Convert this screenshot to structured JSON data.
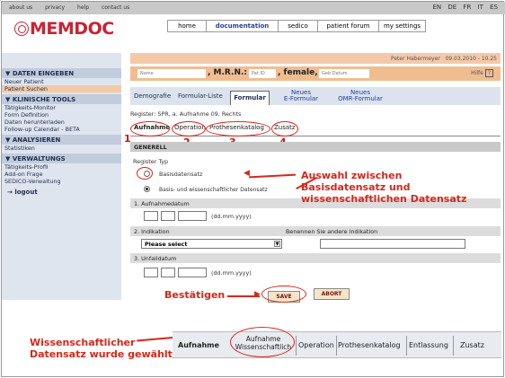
{
  "top_links": [
    "about us",
    "privacy",
    "help",
    "contact us"
  ],
  "languages": [
    "EN",
    "DE",
    "FR",
    "IT",
    "ES"
  ],
  "logo": {
    "text": "MEMDOC"
  },
  "top_nav": [
    {
      "label": "home"
    },
    {
      "label": "documentation"
    },
    {
      "label": "sedico"
    },
    {
      "label": "patient forum"
    },
    {
      "label": "my settings"
    }
  ],
  "sidebar": {
    "sections": [
      {
        "title": "DATEN EINGEBEN",
        "items": [
          "Neuer Patient",
          "Patient Suchen"
        ]
      },
      {
        "title": "KLINISCHE TOOLS",
        "items": [
          "Tätigkeits-Monitor",
          "Form Definition",
          "Daten herunterladen",
          "Follow-up Calendar - BETA"
        ]
      },
      {
        "title": "ANALYSIEREN",
        "items": [
          "Statistiken"
        ]
      },
      {
        "title": "VERWALTUNGS",
        "items": [
          "Tätigkeits-Profil",
          "Add-on Frage",
          "SEDICO-Verwaltung"
        ]
      }
    ],
    "logout": "logout"
  },
  "user_bar": {
    "user": "Peter Habermeyer",
    "date_time": "09.03.2010 - 10.25"
  },
  "patient_bar": {
    "name_field": "Name",
    "mrn_label": ", M.R.N.:",
    "pat_id_field": "Pat ID",
    "gender_label": ", female,",
    "dob_field": "Geb Datum",
    "help_label": "Hilfe",
    "help_icon": "?"
  },
  "form_tabs": [
    {
      "label": "Demografie"
    },
    {
      "label": "Formular-Liste"
    },
    {
      "label": "Formular"
    },
    {
      "line1": "Neues",
      "line2": "E-Formular"
    },
    {
      "line1": "Neues",
      "line2": "OMR-Formular"
    }
  ],
  "register_line": "Register: SPR, a. Aufnahme 09, Rechts",
  "sub_tabs": [
    "Aufnahme",
    "Operation",
    "Prothesenkatalog",
    "Zusatz"
  ],
  "sub_tab_numbers": [
    "1",
    "2",
    "3",
    "4"
  ],
  "sections": {
    "generell": "GENERELL",
    "register_typ": "Register Typ",
    "radio_basis": "Basisdatensatz",
    "radio_wiss": "Basis- und wissenschaftlicher Datensatz",
    "aufnahmedatum": "1. Aufnahmedatum",
    "date_format": "(dd.mm.yyyy)",
    "indikation": "2. Indikation",
    "andere_indikation": "Benennen Sie andere Indikation",
    "select_value": "Please select",
    "unfalldatum": "3. Unfalldatum"
  },
  "buttons": {
    "save": "SAVE",
    "abort": "ABORT"
  },
  "annotations": {
    "auswahl_line1": "Auswahl zwischen",
    "auswahl_line2": "Basisdatensatz und",
    "auswahl_line3": "wissenschaftlichen Datensatz",
    "bestaetigen": "Bestätigen",
    "wiss_line1": "Wissenschaftlicher",
    "wiss_line2": "Datensatz wurde gewählt"
  },
  "bottom_tabs": [
    {
      "label": "Aufnahme"
    },
    {
      "line1": "Aufnahme",
      "line2": "Wissenschaftlich"
    },
    {
      "label": "Operation"
    },
    {
      "label": "Prothesenkatalog"
    },
    {
      "label": "Entlassung"
    },
    {
      "label": "Zusatz"
    }
  ],
  "colors": {
    "accent_red": "#d7271a",
    "sidebar_bg": "#dfe5ef",
    "orange_bar": "#f0bd91"
  }
}
